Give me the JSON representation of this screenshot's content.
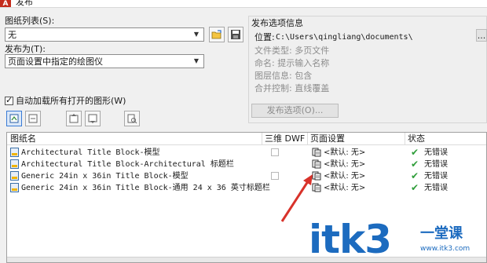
{
  "window": {
    "title": "发布"
  },
  "sheet_list": {
    "label": "图纸列表(S):",
    "value": "无"
  },
  "publish_to": {
    "label": "发布为(T):",
    "value": "页面设置中指定的绘图仪"
  },
  "publish_options_info": {
    "heading": "发布选项信息",
    "location_label": "位置:",
    "location_value": "C:\\Users\\qingliang\\documents\\",
    "location_button": "...",
    "file_type": "文件类型: 多页文件",
    "naming": "命名: 提示输入名称",
    "layer_info": "图层信息: 包含",
    "merge_control": "合并控制: 直线覆盖",
    "options_button": "发布选项(O)..."
  },
  "auto_load": {
    "label": "自动加载所有打开的图形(W)",
    "checked": true
  },
  "table": {
    "columns": [
      "图纸名",
      "三维 DWF",
      "页面设置",
      "状态"
    ],
    "rows": [
      {
        "name": "Architectural Title Block-模型",
        "dwf_checkbox": true,
        "page_setup": "<默认: 无>",
        "status": "无错误"
      },
      {
        "name": "Architectural Title Block-Architectural 标题栏",
        "dwf_checkbox": false,
        "page_setup": "<默认: 无>",
        "status": "无错误"
      },
      {
        "name": "Generic 24in x 36in Title Block-模型",
        "dwf_checkbox": true,
        "page_setup": "<默认: 无>",
        "status": "无错误"
      },
      {
        "name": "Generic 24in x 36in Title Block-通用 24 x 36 英寸标题栏",
        "dwf_checkbox": false,
        "page_setup": "<默认: 无>",
        "status": "无错误"
      }
    ]
  },
  "watermark": {
    "brand": "itk3",
    "chinese": "一堂课",
    "url": "www.itk3.com"
  },
  "colors": {
    "arrow": "#d8322a",
    "ok": "#2f9e3a",
    "watermark": "#1c6bbf"
  }
}
